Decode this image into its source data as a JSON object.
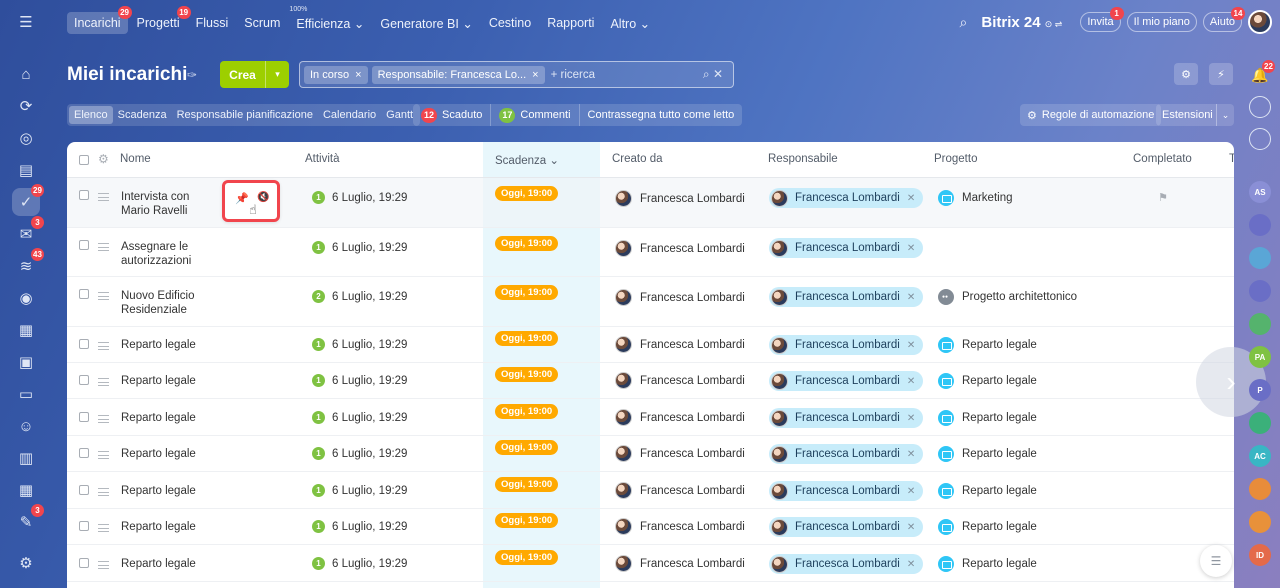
{
  "nav": {
    "items": [
      {
        "label": "Incarichi",
        "badge": "29",
        "sup": ""
      },
      {
        "label": "Progetti",
        "badge": "19",
        "sup": ""
      },
      {
        "label": "Flussi",
        "badge": "",
        "sup": ""
      },
      {
        "label": "Scrum",
        "badge": "",
        "sup": ""
      },
      {
        "label": "Efficienza ⌄",
        "badge": "",
        "sup": "100%"
      },
      {
        "label": "Generatore BI ⌄",
        "badge": "",
        "sup": ""
      },
      {
        "label": "Cestino",
        "badge": "",
        "sup": ""
      },
      {
        "label": "Rapporti",
        "badge": "",
        "sup": ""
      },
      {
        "label": "Altro ⌄",
        "badge": "",
        "sup": ""
      }
    ]
  },
  "topbar": {
    "brand": "Bitrix 24",
    "brand_suffix": "⊙ ⇌",
    "invite": "Invita",
    "invite_badge": "1",
    "plan": "Il mio piano",
    "help": "Aiuto",
    "help_badge": "14"
  },
  "header": {
    "title": "Miei incarichi",
    "create_label": "Crea",
    "filter_chips": [
      "In corso",
      "Responsabile: Francesca Lo..."
    ],
    "search_placeholder": "+ ricerca"
  },
  "view_tabs": [
    "Elenco",
    "Scadenza",
    "Responsabile pianificazione",
    "Calendario",
    "Gantt"
  ],
  "counters": [
    {
      "count": "12",
      "label": "Scaduto",
      "color": "#f1454d"
    },
    {
      "count": "17",
      "label": "Commenti",
      "color": "#7fc242"
    },
    {
      "count": "",
      "label": "Contrassegna tutto come letto",
      "color": ""
    }
  ],
  "toolbar": {
    "automation": "Regole di automazione",
    "extensions": "Estensioni"
  },
  "table": {
    "columns": [
      "Nome",
      "Attività",
      "Scadenza ⌄",
      "Creato da",
      "Responsabile",
      "Progetto",
      "Completato",
      "T"
    ],
    "rows": [
      {
        "name": "Intervista con Mario Ravelli",
        "activity_count": "1",
        "activity": "6 Luglio, 19:29",
        "deadline": "Oggi, 19:00",
        "creator": "Francesca Lombardi",
        "responsible": "Francesca Lombardi",
        "project": "Marketing",
        "project_type": "folder",
        "flag": true
      },
      {
        "name": "Assegnare le autorizzazioni",
        "activity_count": "1",
        "activity": "6 Luglio, 19:29",
        "deadline": "Oggi, 19:00",
        "creator": "Francesca Lombardi",
        "responsible": "Francesca Lombardi",
        "project": "",
        "project_type": "",
        "flag": false
      },
      {
        "name": "Nuovo Edificio Residenziale",
        "activity_count": "2",
        "activity": "6 Luglio, 19:29",
        "deadline": "Oggi, 19:00",
        "creator": "Francesca Lombardi",
        "responsible": "Francesca Lombardi",
        "project": "Progetto architettonico",
        "project_type": "group",
        "flag": false
      },
      {
        "name": "Reparto legale",
        "activity_count": "1",
        "activity": "6 Luglio, 19:29",
        "deadline": "Oggi, 19:00",
        "creator": "Francesca Lombardi",
        "responsible": "Francesca Lombardi",
        "project": "Reparto legale",
        "project_type": "folder",
        "flag": false
      },
      {
        "name": "Reparto legale",
        "activity_count": "1",
        "activity": "6 Luglio, 19:29",
        "deadline": "Oggi, 19:00",
        "creator": "Francesca Lombardi",
        "responsible": "Francesca Lombardi",
        "project": "Reparto legale",
        "project_type": "folder",
        "flag": false
      },
      {
        "name": "Reparto legale",
        "activity_count": "1",
        "activity": "6 Luglio, 19:29",
        "deadline": "Oggi, 19:00",
        "creator": "Francesca Lombardi",
        "responsible": "Francesca Lombardi",
        "project": "Reparto legale",
        "project_type": "folder",
        "flag": false
      },
      {
        "name": "Reparto legale",
        "activity_count": "1",
        "activity": "6 Luglio, 19:29",
        "deadline": "Oggi, 19:00",
        "creator": "Francesca Lombardi",
        "responsible": "Francesca Lombardi",
        "project": "Reparto legale",
        "project_type": "folder",
        "flag": false
      },
      {
        "name": "Reparto legale",
        "activity_count": "1",
        "activity": "6 Luglio, 19:29",
        "deadline": "Oggi, 19:00",
        "creator": "Francesca Lombardi",
        "responsible": "Francesca Lombardi",
        "project": "Reparto legale",
        "project_type": "folder",
        "flag": false
      },
      {
        "name": "Reparto legale",
        "activity_count": "1",
        "activity": "6 Luglio, 19:29",
        "deadline": "Oggi, 19:00",
        "creator": "Francesca Lombardi",
        "responsible": "Francesca Lombardi",
        "project": "Reparto legale",
        "project_type": "folder",
        "flag": false
      },
      {
        "name": "Reparto legale",
        "activity_count": "1",
        "activity": "6 Luglio, 19:29",
        "deadline": "Oggi, 19:00",
        "creator": "Francesca Lombardi",
        "responsible": "Francesca Lombardi",
        "project": "Reparto legale",
        "project_type": "folder",
        "flag": false
      }
    ]
  },
  "left_rail": [
    {
      "icon": "menu-icon",
      "badge": ""
    },
    {
      "icon": "home-icon",
      "badge": ""
    },
    {
      "icon": "automation-icon",
      "badge": ""
    },
    {
      "icon": "chat-icon",
      "badge": ""
    },
    {
      "icon": "feed-icon",
      "badge": ""
    },
    {
      "icon": "tasks-icon",
      "badge": "29"
    },
    {
      "icon": "mail-icon",
      "badge": "3"
    },
    {
      "icon": "crm-icon",
      "badge": "43"
    },
    {
      "icon": "target-icon",
      "badge": ""
    },
    {
      "icon": "calendar-icon",
      "badge": ""
    },
    {
      "icon": "documents-icon",
      "badge": ""
    },
    {
      "icon": "storage-icon",
      "badge": ""
    },
    {
      "icon": "contacts-icon",
      "badge": ""
    },
    {
      "icon": "board-icon",
      "badge": ""
    },
    {
      "icon": "schedule-icon",
      "badge": ""
    },
    {
      "icon": "sign-icon",
      "badge": "3"
    },
    {
      "icon": "settings-icon",
      "badge": ""
    }
  ],
  "right_rail": [
    {
      "label": "AS",
      "color": "#8a8fd6"
    },
    {
      "label": "",
      "color": "#6a6ec6"
    },
    {
      "label": "",
      "color": "#5aa6d6"
    },
    {
      "label": "",
      "color": "#6a6ec6"
    },
    {
      "label": "",
      "color": "#55b36d"
    },
    {
      "label": "PA",
      "color": "#7fc242"
    },
    {
      "label": "P",
      "color": "#6a6ec6"
    },
    {
      "label": "",
      "color": "#3bb07a"
    },
    {
      "label": "AC",
      "color": "#39b6c4"
    },
    {
      "label": "",
      "color": "#e88c3a"
    },
    {
      "label": "",
      "color": "#e8913a"
    },
    {
      "label": "ID",
      "color": "#e46a4a"
    }
  ],
  "right_rail_top_badge": "22",
  "colors": {
    "accent_green": "#9dcf00",
    "deadline_orange": "#ffa900",
    "badge_red": "#f1454d",
    "responsible_chip": "#c7ecfa"
  }
}
